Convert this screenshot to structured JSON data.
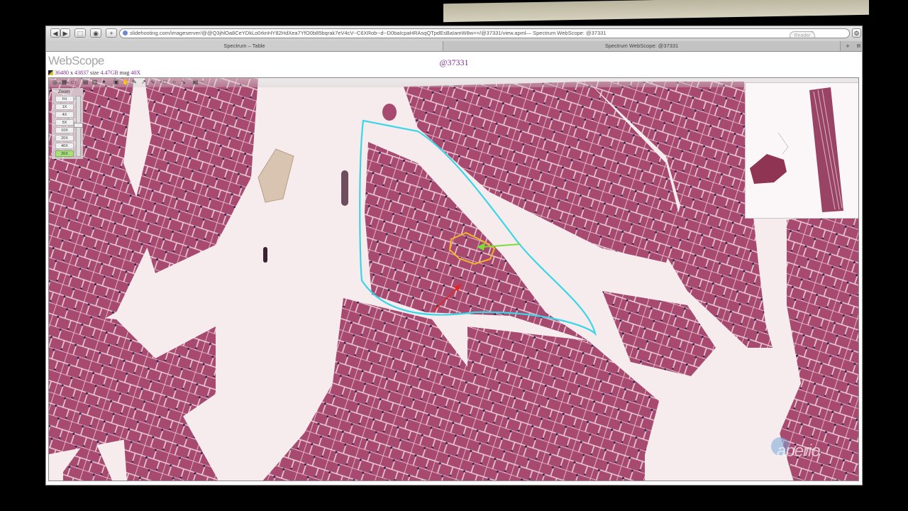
{
  "browser": {
    "url": "slidehosting.com/imageserver/@@Q3jhlOa8CeYDkLo0rknHY82HdXea7YfO0b85bqrak7eV4cV--C6XRob--d--D0baIcpaHRAsqQTpdEsBaIamW8w==/@37331/view.apml— Spectrum WebScope: @37331",
    "reader_label": "Reader",
    "tabs": [
      "Spectrum – Table",
      "Spectrum WebScope: @37331"
    ],
    "nav": {
      "back": "◀",
      "forward": "▶",
      "share": "⬚",
      "stop": "◉",
      "add": "+",
      "reload": "C",
      "settings": "⚙"
    }
  },
  "viewer_header": {
    "logo": "WebScope",
    "image_id": "@37331",
    "info": {
      "width": "36480",
      "x_sep": "x",
      "height": "43837",
      "size_label": "size",
      "size": "4.47GB",
      "mag_label": "mag",
      "mag": "40X"
    }
  },
  "zoom": {
    "title": "Zoom",
    "levels": [
      "Fit",
      "1X",
      "4X",
      "5X",
      "10X",
      "20X",
      "40X",
      "20X"
    ],
    "selected_index": 7
  },
  "tool_icons": [
    "overview-icon",
    "nav-icon",
    "ruler-icon",
    "select-icon",
    "edit-icon",
    "annotation-icon",
    "save-icon",
    "hand-icon",
    "pen-icon",
    "arrow-icon",
    "line-icon",
    "rect-icon",
    "ellipse-icon",
    "pointer-icon",
    "list-icon"
  ],
  "annotations": {
    "outline_color": "#39d6e8",
    "fiber_outline_color": "#f2b52b",
    "arrow_green": "#7cdc3a",
    "arrow_red": "#e32628"
  },
  "colors": {
    "tissue": "#a84a6f",
    "background": "#f6ecee"
  },
  "watermark": "aperio"
}
